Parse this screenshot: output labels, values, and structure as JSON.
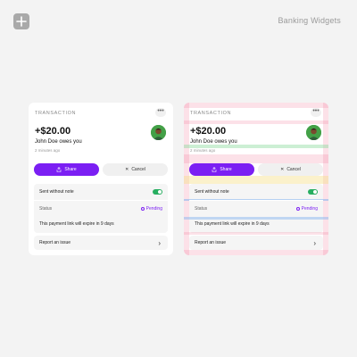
{
  "header": {
    "title": "Banking Widgets"
  },
  "card": {
    "label": "TRANSACTION",
    "menu_label": "•••",
    "amount": "+$20.00",
    "description": "John Doe owes you",
    "timestamp": "2 minutes ago",
    "share_label": "Share",
    "cancel_label": "Cancel",
    "note_label": "Sent without note",
    "status_label": "Status",
    "status_value": "Pending",
    "expiry_text": "This payment link will expire in 9 days",
    "report_label": "Report an issue"
  },
  "colors": {
    "accent": "#7b1ff3",
    "toggle_on": "#27ae60",
    "avatar_bg": "#4caf50",
    "overlay_pink": "#f278a0",
    "overlay_green": "#8fdba0",
    "overlay_blue": "#8ab8f0",
    "overlay_yellow": "#f7e08c"
  }
}
